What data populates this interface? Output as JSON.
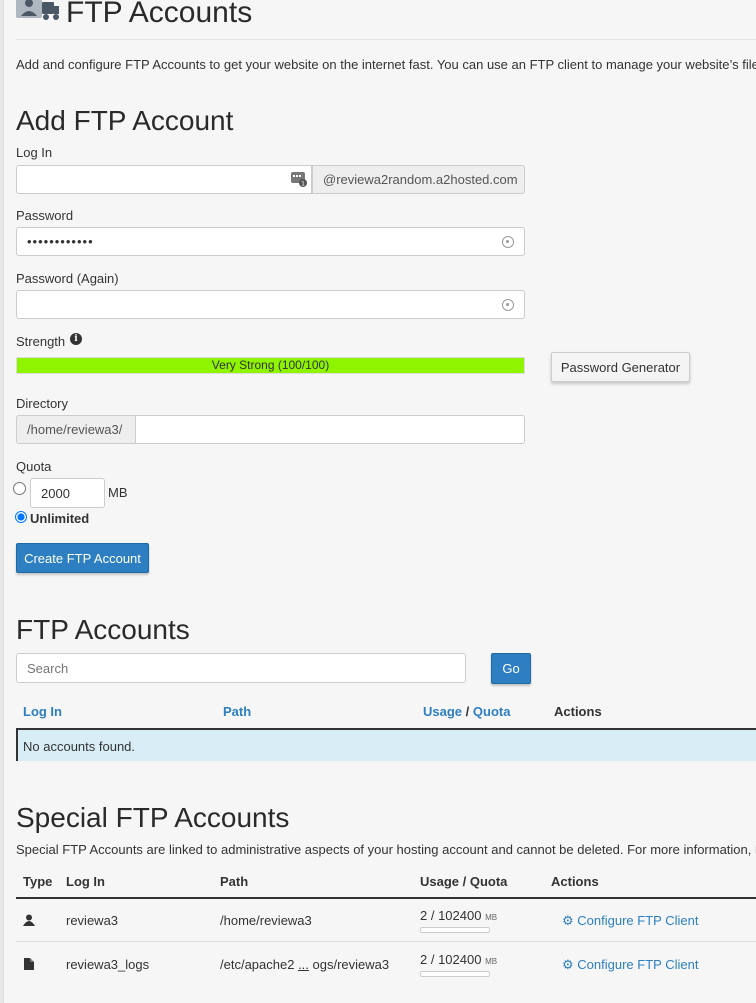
{
  "page": {
    "title": "FTP Accounts",
    "description": "Add and configure FTP Accounts to get your website on the internet fast. You can use an FTP client to manage your website’s files. F"
  },
  "add_form": {
    "heading": "Add FTP Account",
    "login_label": "Log In",
    "login_value": "",
    "domain_suffix": "@reviewa2random.a2hosted.com",
    "password_label": "Password",
    "password_value": "••••••••••••",
    "password_again_label": "Password (Again)",
    "password_again_value": "",
    "strength_label": "Strength",
    "strength_text": "Very Strong (100/100)",
    "strength_percent": 100,
    "strength_color": "#8ef400",
    "password_generator_label": "Password Generator",
    "directory_label": "Directory",
    "directory_prefix": "/home/reviewa3/",
    "directory_value": "",
    "quota_label": "Quota",
    "quota_value": "2000",
    "quota_unit": "MB",
    "unlimited_label": "Unlimited",
    "unlimited_selected": true,
    "create_button": "Create FTP Account"
  },
  "accounts": {
    "heading": "FTP Accounts",
    "search_placeholder": "Search",
    "go_button": "Go",
    "columns": {
      "login": "Log In",
      "path": "Path",
      "usage": "Usage",
      "separator": "/",
      "quota": "Quota",
      "actions": "Actions"
    },
    "empty_message": "No accounts found."
  },
  "special": {
    "heading": "Special FTP Accounts",
    "description": "Special FTP Accounts are linked to administrative aspects of your hosting account and cannot be deleted. For more information, rea",
    "columns": {
      "type": "Type",
      "login": "Log In",
      "path": "Path",
      "usage_quota": "Usage / Quota",
      "actions": "Actions"
    },
    "rows": [
      {
        "icon": "user-icon",
        "login": "reviewa3",
        "path": "/home/reviewa3",
        "usage": "2 / 102400",
        "unit": "MB",
        "usage_fraction": 0.0,
        "action": "Configure FTP Client"
      },
      {
        "icon": "file-icon",
        "login": "reviewa3_logs",
        "path_start": "/etc/apache2 ",
        "path_ellipsis": "...",
        "path_end": " ogs/reviewa3",
        "usage": "2 / 102400",
        "unit": "MB",
        "usage_fraction": 0.0,
        "action": "Configure FTP Client"
      }
    ]
  },
  "colors": {
    "accent": "#2d7fc1",
    "empty_row_bg": "#d9edf7",
    "strength_bar": "#8ef400"
  }
}
